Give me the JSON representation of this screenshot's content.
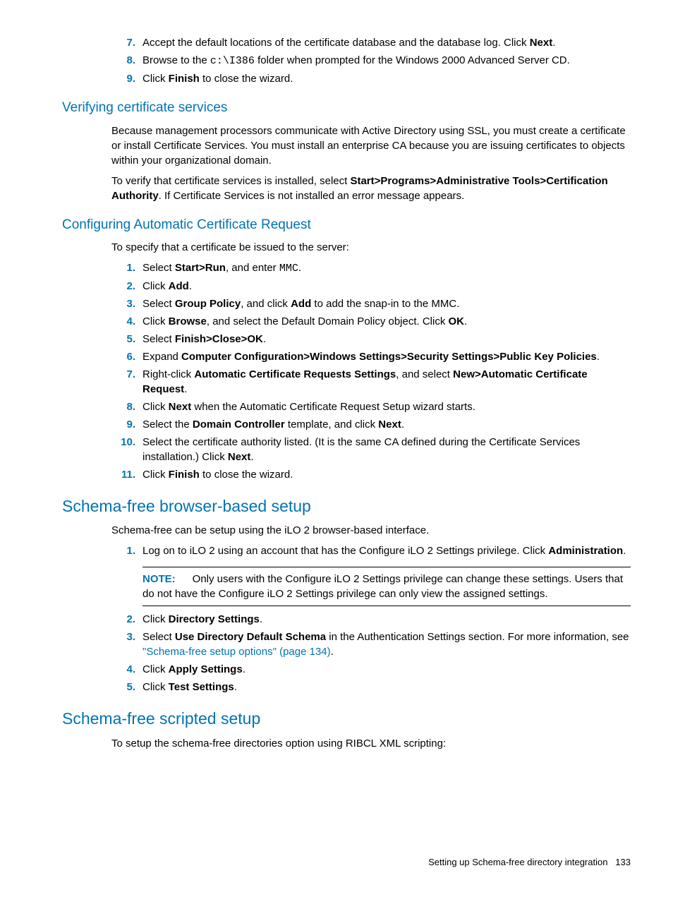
{
  "topList": [
    {
      "n": "7.",
      "html": "Accept the default locations of the certificate database and the database log. Click <b>Next</b>."
    },
    {
      "n": "8.",
      "html": "Browse to the <span class='mono'>c:\\I386</span> folder when prompted for the Windows 2000 Advanced Server CD."
    },
    {
      "n": "9.",
      "html": "Click <b>Finish</b> to close the wizard."
    }
  ],
  "verifying": {
    "heading": "Verifying certificate services",
    "p1": "Because management processors communicate with Active Directory using SSL, you must create a certificate or install Certificate Services. You must install an enterprise CA because you are issuing certificates to objects within your organizational domain.",
    "p2": "To verify that certificate services is installed, select <b>Start>Programs>Administrative Tools>Certification Authority</b>. If Certificate Services is not installed an error message appears."
  },
  "configuring": {
    "heading": "Configuring Automatic Certificate Request",
    "intro": "To specify that a certificate be issued to the server:",
    "list": [
      {
        "n": "1.",
        "html": "Select <b>Start>Run</b>, and enter <span class='mono'>MMC</span>."
      },
      {
        "n": "2.",
        "html": "Click <b>Add</b>."
      },
      {
        "n": "3.",
        "html": "Select <b>Group Policy</b>, and click <b>Add</b> to add the snap-in to the MMC."
      },
      {
        "n": "4.",
        "html": "Click <b>Browse</b>, and select the Default Domain Policy object. Click <b>OK</b>."
      },
      {
        "n": "5.",
        "html": "Select <b>Finish>Close>OK</b>."
      },
      {
        "n": "6.",
        "html": "Expand <b>Computer Configuration>Windows Settings>Security Settings>Public Key Policies</b>."
      },
      {
        "n": "7.",
        "html": "Right-click <b>Automatic Certificate Requests Settings</b>, and select <b>New>Automatic Certificate Request</b>."
      },
      {
        "n": "8.",
        "html": "Click <b>Next</b> when the Automatic Certificate Request Setup wizard starts."
      },
      {
        "n": "9.",
        "html": "Select the <b>Domain Controller</b> template, and click <b>Next</b>."
      },
      {
        "n": "10.",
        "html": "Select the certificate authority listed. (It is the same CA defined during the Certificate Services installation.) Click <b>Next</b>."
      },
      {
        "n": "11.",
        "html": "Click <b>Finish</b> to close the wizard."
      }
    ]
  },
  "browserSetup": {
    "heading": "Schema-free browser-based setup",
    "intro": "Schema-free can be setup using the iLO 2 browser-based interface.",
    "list1": [
      {
        "n": "1.",
        "html": "Log on to iLO 2 using an account that has the Configure iLO 2 Settings privilege. Click <b>Administration</b>."
      }
    ],
    "note": {
      "label": "NOTE:",
      "text": "Only users with the Configure iLO 2 Settings privilege can change these settings. Users that do not have the Configure iLO 2 Settings privilege can only view the assigned settings."
    },
    "list2": [
      {
        "n": "2.",
        "html": "Click <b>Directory Settings</b>."
      },
      {
        "n": "3.",
        "html": "Select <b>Use Directory Default Schema</b> in the Authentication Settings section. For more information, see <a class='xref' href='#'>\"Schema-free setup options\" (page 134)</a>."
      },
      {
        "n": "4.",
        "html": "Click <b>Apply Settings</b>."
      },
      {
        "n": "5.",
        "html": "Click <b>Test Settings</b>."
      }
    ]
  },
  "scriptedSetup": {
    "heading": "Schema-free scripted setup",
    "intro": "To setup the schema-free directories option using RIBCL XML scripting:"
  },
  "footer": {
    "text": "Setting up Schema-free directory integration",
    "page": "133"
  }
}
